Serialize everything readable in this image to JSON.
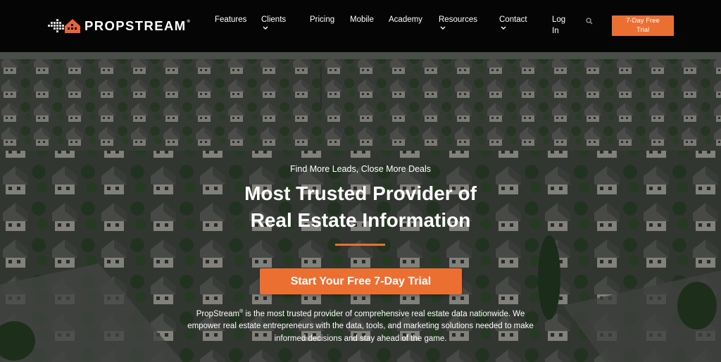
{
  "brand": {
    "name": "PROPSTREAM",
    "registered_mark": "®"
  },
  "nav": {
    "items": [
      {
        "label": "Features",
        "has_dropdown": false
      },
      {
        "label": "Clients",
        "has_dropdown": true
      },
      {
        "label": "Pricing",
        "has_dropdown": false
      },
      {
        "label": "Mobile",
        "has_dropdown": false
      },
      {
        "label": "Academy",
        "has_dropdown": false
      },
      {
        "label": "Resources",
        "has_dropdown": true
      },
      {
        "label": "Contact",
        "has_dropdown": true
      }
    ],
    "login_line1": "Log",
    "login_line2": "In",
    "search_icon": "search-icon",
    "trial_line1": "7-Day Free",
    "trial_line2": "Trial"
  },
  "hero": {
    "eyebrow": "Find More Leads, Close More Deals",
    "headline_line1": "Most Trusted Provider of",
    "headline_line2": "Real Estate Information",
    "cta_label": "Start Your Free 7-Day Trial",
    "desc_brand": "PropStream",
    "desc_mark": "®",
    "desc_rest": " is the most trusted provider of comprehensive real estate data nationwide. We empower real estate entrepreneurs with the data, tools, and marketing solutions needed to make informed decisions and stay ahead of the game."
  },
  "colors": {
    "accent": "#ec6f32",
    "nav_bg": "#050505",
    "logo_accent": "#e8643a"
  }
}
